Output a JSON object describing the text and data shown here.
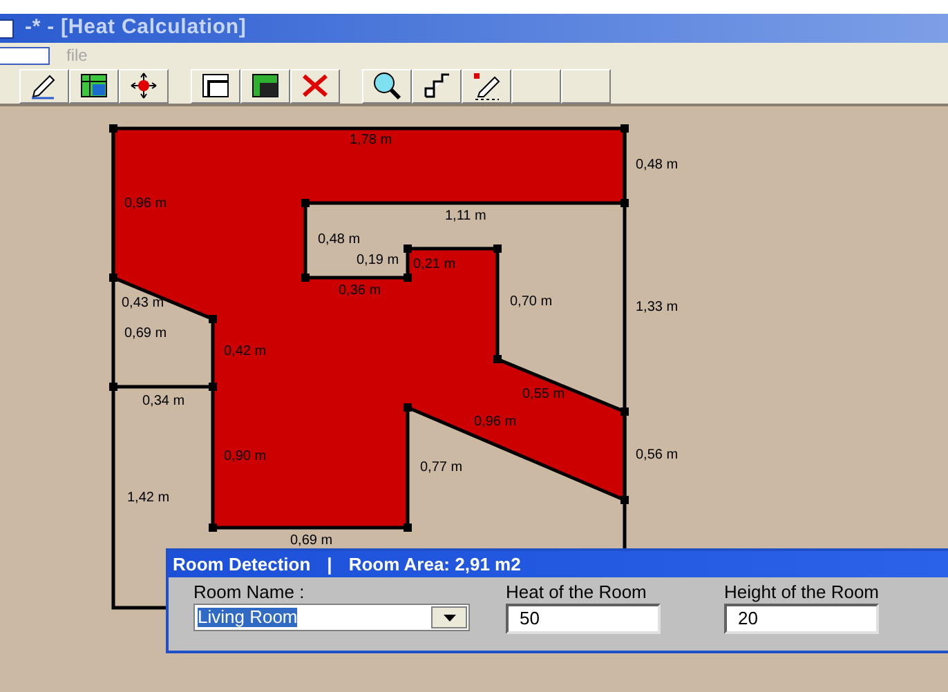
{
  "window": {
    "title": "-* - [Heat Calculation]"
  },
  "menu": [
    {
      "label": "file",
      "disabled": true
    }
  ],
  "toolbar": [
    {
      "kind": "pencil"
    },
    {
      "kind": "grid"
    },
    {
      "kind": "move"
    },
    {
      "kind": "outline"
    },
    {
      "kind": "filled"
    },
    {
      "kind": "delete"
    },
    {
      "kind": "zoom"
    },
    {
      "kind": "steps"
    },
    {
      "kind": "rename"
    },
    {
      "kind": "blank"
    },
    {
      "kind": "blank"
    }
  ],
  "plan": {
    "labels": [
      {
        "text": "1,78 m"
      },
      {
        "text": "0,48 m"
      },
      {
        "text": "0,96 m"
      },
      {
        "text": "1,11 m"
      },
      {
        "text": "0,48 m"
      },
      {
        "text": "0,19 m"
      },
      {
        "text": "0,21 m"
      },
      {
        "text": "0,43 m"
      },
      {
        "text": "0,36 m"
      },
      {
        "text": "0,70 m"
      },
      {
        "text": "1,33 m"
      },
      {
        "text": "0,69 m"
      },
      {
        "text": "0,42 m"
      },
      {
        "text": "0,55 m"
      },
      {
        "text": "0,34 m"
      },
      {
        "text": "0,96 m"
      },
      {
        "text": "0,56 m"
      },
      {
        "text": "0,90 m"
      },
      {
        "text": "0,77 m"
      },
      {
        "text": "1,42 m"
      },
      {
        "text": "0,69 m"
      }
    ]
  },
  "dialog": {
    "title": "Room Detection",
    "separator": "|",
    "area": "Room Area: 2,91 m2",
    "room_name": {
      "label": "Room Name :",
      "value": "Living Room"
    },
    "heat": {
      "label": "Heat of the Room",
      "value": "50"
    },
    "height": {
      "label": "Height of the Room",
      "value": "20"
    }
  }
}
